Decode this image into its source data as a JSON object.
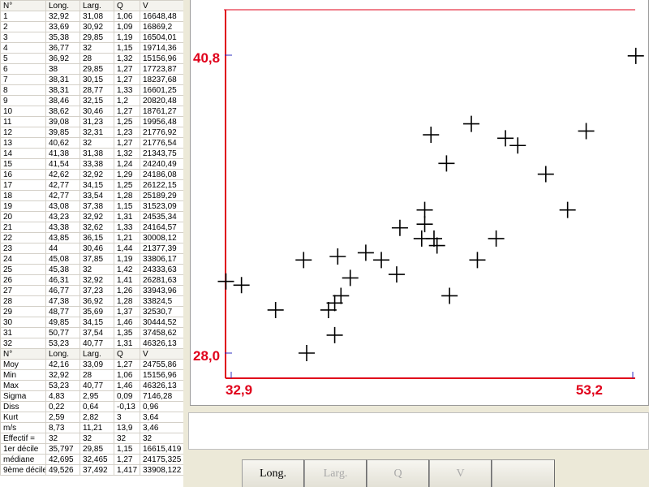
{
  "table": {
    "header": [
      "N°",
      "Long.",
      "Larg.",
      "Q",
      "V"
    ],
    "rows": [
      [
        "1",
        "32,92",
        "31,08",
        "1,06",
        "16648,48"
      ],
      [
        "2",
        "33,69",
        "30,92",
        "1,09",
        "16869,2"
      ],
      [
        "3",
        "35,38",
        "29,85",
        "1,19",
        "16504,01"
      ],
      [
        "4",
        "36,77",
        "32",
        "1,15",
        "19714,36"
      ],
      [
        "5",
        "36,92",
        "28",
        "1,32",
        "15156,96"
      ],
      [
        "6",
        "38",
        "29,85",
        "1,27",
        "17723,87"
      ],
      [
        "7",
        "38,31",
        "30,15",
        "1,27",
        "18237,68"
      ],
      [
        "8",
        "38,31",
        "28,77",
        "1,33",
        "16601,25"
      ],
      [
        "9",
        "38,46",
        "32,15",
        "1,2",
        "20820,48"
      ],
      [
        "10",
        "38,62",
        "30,46",
        "1,27",
        "18761,27"
      ],
      [
        "11",
        "39,08",
        "31,23",
        "1,25",
        "19956,48"
      ],
      [
        "12",
        "39,85",
        "32,31",
        "1,23",
        "21776,92"
      ],
      [
        "13",
        "40,62",
        "32",
        "1,27",
        "21776,54"
      ],
      [
        "14",
        "41,38",
        "31,38",
        "1,32",
        "21343,75"
      ],
      [
        "15",
        "41,54",
        "33,38",
        "1,24",
        "24240,49"
      ],
      [
        "16",
        "42,62",
        "32,92",
        "1,29",
        "24186,08"
      ],
      [
        "17",
        "42,77",
        "34,15",
        "1,25",
        "26122,15"
      ],
      [
        "18",
        "42,77",
        "33,54",
        "1,28",
        "25189,29"
      ],
      [
        "19",
        "43,08",
        "37,38",
        "1,15",
        "31523,09"
      ],
      [
        "20",
        "43,23",
        "32,92",
        "1,31",
        "24535,34"
      ],
      [
        "21",
        "43,38",
        "32,62",
        "1,33",
        "24164,57"
      ],
      [
        "22",
        "43,85",
        "36,15",
        "1,21",
        "30008,12"
      ],
      [
        "23",
        "44",
        "30,46",
        "1,44",
        "21377,39"
      ],
      [
        "24",
        "45,08",
        "37,85",
        "1,19",
        "33806,17"
      ],
      [
        "25",
        "45,38",
        "32",
        "1,42",
        "24333,63"
      ],
      [
        "26",
        "46,31",
        "32,92",
        "1,41",
        "26281,63"
      ],
      [
        "27",
        "46,77",
        "37,23",
        "1,26",
        "33943,96"
      ],
      [
        "28",
        "47,38",
        "36,92",
        "1,28",
        "33824,5"
      ],
      [
        "29",
        "48,77",
        "35,69",
        "1,37",
        "32530,7"
      ],
      [
        "30",
        "49,85",
        "34,15",
        "1,46",
        "30444,52"
      ],
      [
        "31",
        "50,77",
        "37,54",
        "1,35",
        "37458,62"
      ],
      [
        "32",
        "53,23",
        "40,77",
        "1,31",
        "46326,13"
      ]
    ],
    "stats_header": [
      "N°",
      "Long.",
      "Larg.",
      "Q",
      "V"
    ],
    "stats": [
      [
        "Moy",
        "42,16",
        "33,09",
        "1,27",
        "24755,86"
      ],
      [
        "Min",
        "32,92",
        "28",
        "1,06",
        "15156,96"
      ],
      [
        "Max",
        "53,23",
        "40,77",
        "1,46",
        "46326,13"
      ],
      [
        "Sigma",
        "4,83",
        "2,95",
        "0,09",
        "7146,28"
      ],
      [
        "Diss",
        "0,22",
        "0,64",
        "-0,13",
        "0,96"
      ],
      [
        "Kurt",
        "2,59",
        "2,82",
        "3",
        "3,64"
      ],
      [
        "m/s",
        "8,73",
        "11,21",
        "13,9",
        "3,46"
      ],
      [
        "Effectif =",
        "32",
        "32",
        "32",
        "32"
      ],
      [
        "1er décile",
        "35,797",
        "29,85",
        "1,15",
        "16615,419"
      ],
      [
        "médiane",
        "42,695",
        "32,465",
        "1,27",
        "24175,325"
      ],
      [
        "9ème décile",
        "49,526",
        "37,492",
        "1,417",
        "33908,122"
      ]
    ]
  },
  "plot": {
    "axis_labels": {
      "x_min": "32,9",
      "x_max": "53,2",
      "y_min": "28,0",
      "y_max": "40,8"
    },
    "colors": {
      "axis": "#e0001a",
      "marker": "#000000",
      "tick": "#3030c0"
    }
  },
  "chart_data": {
    "type": "scatter",
    "xlim": [
      32.9,
      53.2
    ],
    "ylim": [
      28.0,
      40.8
    ],
    "x": [
      32.92,
      33.69,
      35.38,
      36.77,
      36.92,
      38,
      38.31,
      38.31,
      38.46,
      38.62,
      39.08,
      39.85,
      40.62,
      41.38,
      41.54,
      42.62,
      42.77,
      42.77,
      43.08,
      43.23,
      43.38,
      43.85,
      44,
      45.08,
      45.38,
      46.31,
      46.77,
      47.38,
      48.77,
      49.85,
      50.77,
      53.23
    ],
    "y": [
      31.08,
      30.92,
      29.85,
      32,
      28,
      29.85,
      30.15,
      28.77,
      32.15,
      30.46,
      31.23,
      32.31,
      32,
      31.38,
      33.38,
      32.92,
      34.15,
      33.54,
      37.38,
      32.92,
      32.62,
      36.15,
      30.46,
      37.85,
      32,
      32.92,
      37.23,
      36.92,
      35.69,
      34.15,
      37.54,
      40.77
    ]
  },
  "toolbar": {
    "buttons": [
      "Long.",
      "Larg.",
      "Q",
      "V"
    ]
  }
}
